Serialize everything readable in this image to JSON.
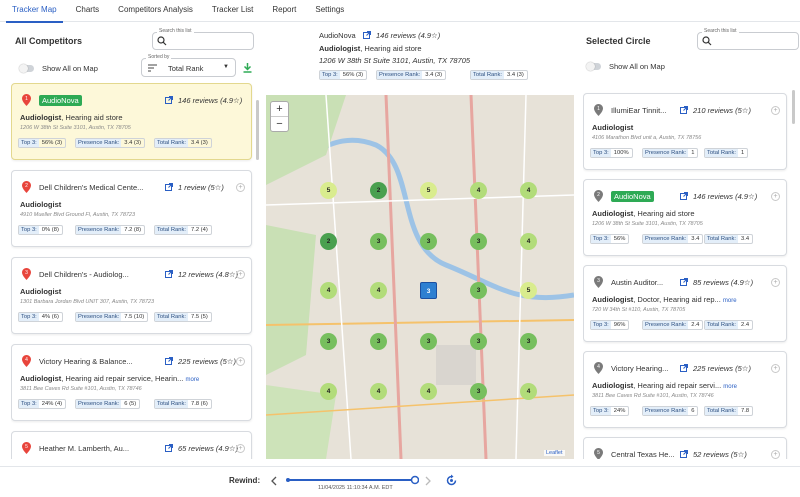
{
  "tabs": [
    {
      "label": "Tracker Map",
      "active": true
    },
    {
      "label": "Charts"
    },
    {
      "label": "Competitors Analysis"
    },
    {
      "label": "Tracker List"
    },
    {
      "label": "Report"
    },
    {
      "label": "Settings"
    }
  ],
  "left_panel": {
    "title": "All Competitors",
    "search": {
      "label": "Search this list",
      "value": ""
    },
    "show_all_label": "Show All on Map",
    "sort": {
      "label": "Sorted by",
      "value": "Total Rank"
    },
    "cards": [
      {
        "rank": "1",
        "name": "AudioNova",
        "is_badge": true,
        "reviews": "146 reviews (4.9☆)",
        "category": "Audiologist",
        "category_rest": ", Hearing aid store",
        "more": "",
        "address": "1206 W 38th St Suite 3101, Austin, TX 78705",
        "top3": "56% (3)",
        "presence": "3.4 (3)",
        "total": "3.4 (3)",
        "selected": true
      },
      {
        "rank": "2",
        "name": "Dell Children's Medical Cente...",
        "is_badge": false,
        "reviews": "1 review (5☆)",
        "category": "Audiologist",
        "category_rest": "",
        "more": "",
        "address": "4910 Mueller Blvd Ground Fl, Austin, TX 78723",
        "top3": "0% (8)",
        "presence": "7.2 (8)",
        "total": "7.2 (4)"
      },
      {
        "rank": "3",
        "name": "Dell Children's - Audiolog...",
        "is_badge": false,
        "reviews": "12 reviews (4.8☆)",
        "category": "Audiologist",
        "category_rest": "",
        "more": "",
        "address": "1301 Barbara Jordan Blvd UNIT 307, Austin, TX 78723",
        "top3": "4% (6)",
        "presence": "7.5 (10)",
        "total": "7.5 (5)"
      },
      {
        "rank": "4",
        "name": "Victory Hearing & Balance...",
        "is_badge": false,
        "reviews": "225 reviews (5☆)",
        "category": "Audiologist",
        "category_rest": ", Hearing aid repair service, Hearin...",
        "more": "more",
        "address": "3811 Bee Caves Rd Suite #101, Austin, TX 78746",
        "top3": "24% (4)",
        "presence": "6 (5)",
        "total": "7.8 (6)"
      },
      {
        "rank": "5",
        "name": "Heather M. Lamberth, Au...",
        "is_badge": false,
        "reviews": "65 reviews (4.9☆)",
        "category": "",
        "category_rest": "",
        "more": "",
        "address": "",
        "top3": "",
        "presence": "",
        "total": ""
      }
    ]
  },
  "center": {
    "name": "AudioNova",
    "reviews": "146 reviews (4.9☆)",
    "category": "Audiologist",
    "category_rest": ", Hearing aid store",
    "address": "1206 W 38th St Suite 3101, Austin, TX 78705",
    "top3": "56% (3)",
    "presence": "3.4 (3)",
    "total": "3.4 (3)",
    "map_attribution": "Leaflet",
    "clusters": [
      {
        "v": "5",
        "c": "#d9ec8e"
      },
      {
        "v": "2",
        "c": "#4aa04f"
      },
      {
        "v": "5",
        "c": "#d9ec8e"
      },
      {
        "v": "4",
        "c": "#b2dc7a"
      },
      {
        "v": "4",
        "c": "#b2dc7a"
      },
      {
        "v": "2",
        "c": "#4aa04f"
      },
      {
        "v": "3",
        "c": "#77bf5e"
      },
      {
        "v": "3",
        "c": "#77bf5e"
      },
      {
        "v": "3",
        "c": "#77bf5e"
      },
      {
        "v": "4",
        "c": "#b2dc7a"
      },
      {
        "v": "4",
        "c": "#b2dc7a"
      },
      {
        "v": "4",
        "c": "#b2dc7a"
      },
      {
        "v": "3",
        "c": "#2d7fd1"
      },
      {
        "v": "3",
        "c": "#77bf5e"
      },
      {
        "v": "5",
        "c": "#d9ec8e"
      },
      {
        "v": "3",
        "c": "#77bf5e"
      },
      {
        "v": "3",
        "c": "#77bf5e"
      },
      {
        "v": "3",
        "c": "#77bf5e"
      },
      {
        "v": "3",
        "c": "#77bf5e"
      },
      {
        "v": "3",
        "c": "#77bf5e"
      },
      {
        "v": "4",
        "c": "#b2dc7a"
      },
      {
        "v": "4",
        "c": "#b2dc7a"
      },
      {
        "v": "4",
        "c": "#b2dc7a"
      },
      {
        "v": "3",
        "c": "#77bf5e"
      },
      {
        "v": "4",
        "c": "#b2dc7a"
      }
    ]
  },
  "right_panel": {
    "title": "Selected Circle",
    "search": {
      "label": "Search this list",
      "value": ""
    },
    "show_all_label": "Show All on Map",
    "cards": [
      {
        "rank": "1",
        "name": "IllumiEar Tinnit...",
        "is_badge": false,
        "reviews": "210 reviews (5☆)",
        "category": "Audiologist",
        "category_rest": "",
        "more": "",
        "address": "4106 Marathon Blvd unit a, Austin, TX 78756",
        "top3": "100%",
        "presence": "1",
        "total": "1"
      },
      {
        "rank": "2",
        "name": "AudioNova",
        "is_badge": true,
        "reviews": "146 reviews (4.9☆)",
        "category": "Audiologist",
        "category_rest": ", Hearing aid store",
        "more": "",
        "address": "1206 W 38th St Suite 3101, Austin, TX 78705",
        "top3": "56%",
        "presence": "3.4",
        "total": "3.4"
      },
      {
        "rank": "3",
        "name": "Austin Auditor...",
        "is_badge": false,
        "reviews": "85 reviews (4.9☆)",
        "category": "Audiologist",
        "category_rest": ", Doctor, Hearing aid rep...",
        "more": "more",
        "address": "720 W 34th St #110, Austin, TX 78705",
        "top3": "96%",
        "presence": "2.4",
        "total": "2.4"
      },
      {
        "rank": "4",
        "name": "Victory Hearing...",
        "is_badge": false,
        "reviews": "225 reviews (5☆)",
        "category": "Audiologist",
        "category_rest": ", Hearing aid repair servi...",
        "more": "more",
        "address": "3811 Bee Caves Rd Suite #101, Austin, TX 78746",
        "top3": "24%",
        "presence": "6",
        "total": "7.8"
      },
      {
        "rank": "5",
        "name": "Central Texas He...",
        "is_badge": false,
        "reviews": "52 reviews (5☆)",
        "category": "",
        "category_rest": "",
        "more": "",
        "address": "",
        "top3": "",
        "presence": "",
        "total": ""
      }
    ]
  },
  "labels": {
    "top3": "Top 3:",
    "presence": "Presence Rank:",
    "total": "Total Rank:",
    "plus": "+"
  },
  "footer": {
    "rewind_label": "Rewind:",
    "timestamp": "11/04/2025 11:10:34 A.M. EDT",
    "progress": 1.0
  },
  "colors": {
    "accent": "#2a5fc4",
    "badge": "#2eaa55",
    "pin": "#e8453c",
    "pin_grey": "#7a7a7a"
  }
}
